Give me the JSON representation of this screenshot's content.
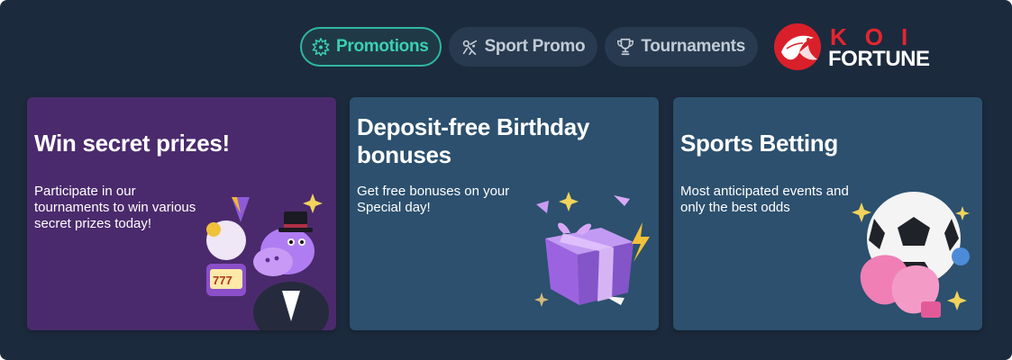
{
  "tabs": [
    {
      "label": "Promotions",
      "icon": "sparkle-badge-icon",
      "active": true
    },
    {
      "label": "Sport Promo",
      "icon": "sport-promo-icon",
      "active": false
    },
    {
      "label": "Tournaments",
      "icon": "trophy-icon",
      "active": false
    }
  ],
  "logo": {
    "top": "KOI",
    "bottom": "FORTUNE"
  },
  "cards": [
    {
      "title": "Win secret prizes!",
      "description": "Participate in our tournaments to win various secret prizes today!",
      "image": "hippo-mascot-slot-machine"
    },
    {
      "title": "Deposit-free Birthday bonuses",
      "description": "Get free bonuses on your Special day!",
      "image": "purple-gift-box"
    },
    {
      "title": "Sports Betting",
      "description": "Most anticipated events and only the best odds",
      "image": "soccer-ball-boxing-gloves"
    }
  ],
  "colors": {
    "background": "#1c2a3d",
    "accent": "#3bd0b6",
    "card_purple": "#4a2a6c",
    "card_blue": "#2c506e",
    "logo_red": "#e6252f"
  }
}
